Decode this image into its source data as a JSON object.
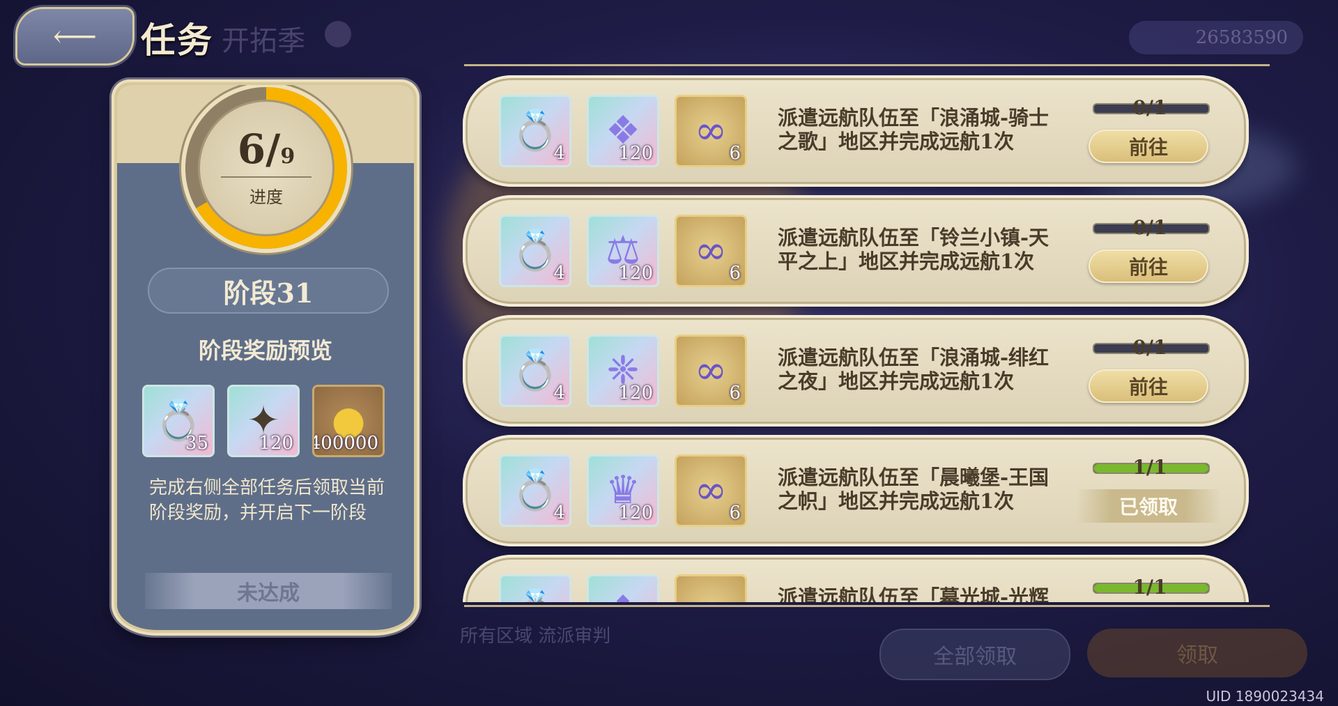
{
  "header": {
    "title": "任务",
    "ghost_title": "开拓季",
    "currency_value": "26583590"
  },
  "stage_panel": {
    "progress_current": "6",
    "progress_total": "9",
    "progress_fraction": 0.667,
    "progress_label": "进度",
    "stage_title": "阶段31",
    "preview_title": "阶段奖励预览",
    "rewards": [
      {
        "icon": "ring-item-icon",
        "qty": "35"
      },
      {
        "icon": "star-crystal-icon",
        "qty": "120"
      },
      {
        "icon": "gold-coin-icon",
        "qty": "400000"
      }
    ],
    "description": "完成右侧全部任务后领取当前阶段奖励，并开启下一阶段",
    "status": "未达成"
  },
  "tasks": [
    {
      "rewards": [
        {
          "icon": "ring-item-icon",
          "qty": "4"
        },
        {
          "icon": "shard-item-icon",
          "qty": "120"
        },
        {
          "icon": "infinity-token-icon",
          "qty": "6"
        }
      ],
      "text": "派遣远航队伍至「浪涌城-骑士之歌」地区并完成远航1次",
      "progress_text": "0/1",
      "progress_fraction": 0,
      "button": "前往",
      "claimed": false
    },
    {
      "rewards": [
        {
          "icon": "ring-item-icon",
          "qty": "4"
        },
        {
          "icon": "libra-item-icon",
          "qty": "120"
        },
        {
          "icon": "infinity-token-icon",
          "qty": "6"
        }
      ],
      "text": "派遣远航队伍至「铃兰小镇-天平之上」地区并完成远航1次",
      "progress_text": "0/1",
      "progress_fraction": 0,
      "button": "前往",
      "claimed": false
    },
    {
      "rewards": [
        {
          "icon": "ring-item-icon",
          "qty": "4"
        },
        {
          "icon": "crystal-item-icon",
          "qty": "120"
        },
        {
          "icon": "infinity-token-icon",
          "qty": "6"
        }
      ],
      "text": "派遣远航队伍至「浪涌城-绯红之夜」地区并完成远航1次",
      "progress_text": "0/1",
      "progress_fraction": 0,
      "button": "前往",
      "claimed": false
    },
    {
      "rewards": [
        {
          "icon": "ring-item-icon",
          "qty": "4"
        },
        {
          "icon": "crown-item-icon",
          "qty": "120"
        },
        {
          "icon": "infinity-token-icon",
          "qty": "6"
        }
      ],
      "text": "派遣远航队伍至「晨曦堡-王国之帜」地区并完成远航1次",
      "progress_text": "1/1",
      "progress_fraction": 1,
      "button": "已领取",
      "claimed": true
    },
    {
      "rewards": [
        {
          "icon": "ring-item-icon",
          "qty": ""
        },
        {
          "icon": "shard-item-icon",
          "qty": ""
        },
        {
          "icon": "infinity-token-icon",
          "qty": ""
        }
      ],
      "text": "派遣远航队伍至「幕光城-光辉",
      "progress_text": "1/1",
      "progress_fraction": 1,
      "button": "",
      "claimed": true
    }
  ],
  "background": {
    "ghost_text": "所有区域 流派审判",
    "claim_all": "全部领取",
    "confirm": "领取"
  },
  "footer": {
    "uid": "UID 1890023434"
  },
  "colors": {
    "accent_yellow": "#f7b300",
    "panel_blue": "#5f6e88",
    "card_cream": "#e6dcc2",
    "progress_green": "#7ab82e"
  }
}
